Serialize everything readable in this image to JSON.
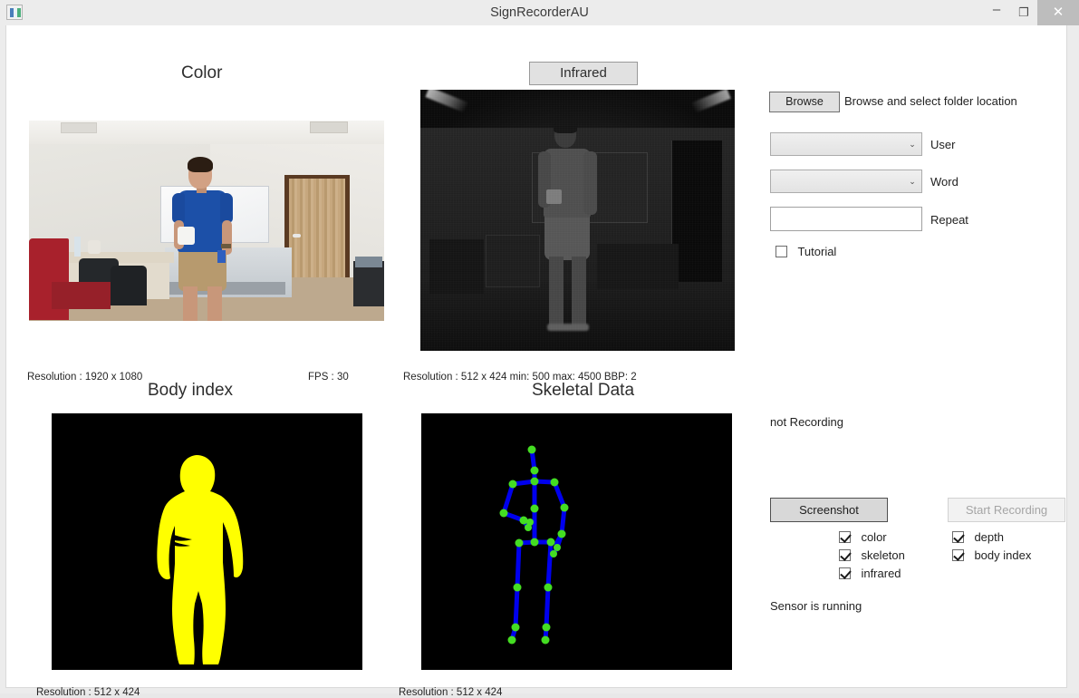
{
  "window": {
    "title": "SignRecorderAU",
    "icon": "app-icon",
    "controls": {
      "minimize": "–",
      "maximize": "❐",
      "close": "✕"
    }
  },
  "panels": {
    "color": {
      "title": "Color",
      "resolution": "Resolution :  1920 x 1080",
      "fps": "FPS :  30"
    },
    "infrared": {
      "title": "Infrared",
      "status": "Resolution :  512 x 424   min: 500  max: 4500 BBP: 2"
    },
    "body_index": {
      "title": "Body index",
      "resolution": "Resolution :  512 x 424"
    },
    "skeletal": {
      "title": "Skeletal Data",
      "resolution": "Resolution :  512 x 424"
    }
  },
  "controls": {
    "browse_button": "Browse",
    "browse_hint": "Browse and select folder location",
    "user_label": "User",
    "user_value": "",
    "word_label": "Word",
    "word_value": "",
    "repeat_label": "Repeat",
    "repeat_value": "",
    "repeat_placeholder": "",
    "tutorial_label": "Tutorial",
    "tutorial_checked": false,
    "dropdown_arrow": "⌄"
  },
  "status": {
    "recording": "not Recording",
    "sensor": "Sensor is running"
  },
  "actions": {
    "screenshot_button": "Screenshot",
    "start_recording_button": "Start Recording",
    "start_recording_enabled": false
  },
  "stream_checkboxes": {
    "left": [
      {
        "label": "color",
        "checked": true
      },
      {
        "label": "skeleton",
        "checked": true
      },
      {
        "label": "infrared",
        "checked": true
      }
    ],
    "right": [
      {
        "label": "depth",
        "checked": true
      },
      {
        "label": "body index",
        "checked": true
      }
    ]
  },
  "colors": {
    "body_index_silhouette": "#ffff00",
    "skeleton_bone": "#0000ee",
    "skeleton_joint": "#44dd22",
    "feed_background": "#000000",
    "window_chrome": "#ececec",
    "close_button": "#bdbdbd"
  }
}
